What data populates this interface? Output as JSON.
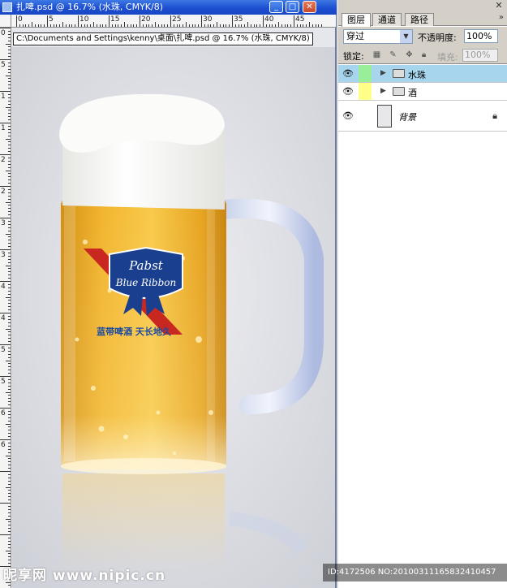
{
  "document_window": {
    "title": "扎啤.psd @ 16.7% (水珠, CMYK/8)",
    "buttons": {
      "minimize": "_",
      "maximize": "□",
      "close": "✕"
    },
    "path_tooltip": "C:\\Documents and Settings\\kenny\\桌面\\扎啤.psd @ 16.7% (水珠, CMYK/8)",
    "ruler_h_numbers": [
      "0",
      "5",
      "10",
      "15",
      "20",
      "25",
      "30",
      "35",
      "40",
      "45"
    ],
    "ruler_v_numbers": [
      "0",
      "5",
      "1",
      "1",
      "2",
      "2",
      "3",
      "3",
      "4",
      "4",
      "5",
      "5",
      "6",
      "6"
    ]
  },
  "canvas_content": {
    "brand_badge_top": "Pabst",
    "brand_badge_bottom": "Blue Ribbon",
    "slogan": "蓝带啤酒 天长地久"
  },
  "layers_panel": {
    "tabs": [
      "图层",
      "通道",
      "路径"
    ],
    "active_tab": "图层",
    "blend_mode": "穿过",
    "opacity_label": "不透明度:",
    "opacity_value": "100%",
    "lock_label": "锁定:",
    "fill_label": "填充:",
    "fill_value": "100%",
    "layers": [
      {
        "name": "水珠",
        "type": "group",
        "visible": true,
        "color": "#99ee99",
        "selected": true
      },
      {
        "name": "酒",
        "type": "group",
        "visible": true,
        "color": "#ffff88",
        "selected": false
      },
      {
        "name": "背景",
        "type": "background",
        "visible": true,
        "locked": true,
        "selected": false
      }
    ],
    "selected_color": "#a7d5ee"
  },
  "watermark": {
    "left": "昵享网 www.nipic.cn",
    "right": "ID:4172506 NO:20100311165832410457"
  }
}
